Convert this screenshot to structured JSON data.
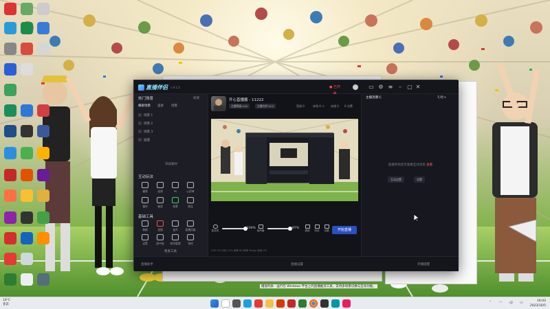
{
  "colors": {
    "accent": "#2a4fbf",
    "live_red": "#ff4d4d",
    "app_bg": "#17181f"
  },
  "app": {
    "title": "直播伴侣",
    "version": "v 9.1.0",
    "titlebar_buttons": [
      "minimize-icon",
      "maximize-icon",
      "close-icon"
    ],
    "left": {
      "section_title": "热门场景",
      "section_action": "新建",
      "tabs": [
        "横屏场景",
        "竖屏",
        "场景"
      ],
      "scenes": [
        "场景 1",
        "场景 2",
        "场景 3",
        "画面"
      ],
      "add_source": "添加素材",
      "interaction_title": "互动玩法",
      "interaction_tools": [
        "福袋",
        "连线",
        "PK",
        "心愿单",
        "福利",
        "抽奖",
        "投票",
        "商品"
      ],
      "basic_title": "基础工具",
      "basic_tools": [
        "美颜",
        "滤镜",
        "变声",
        "直播回放",
        "设置",
        "画中画",
        "房间管理",
        "场控"
      ],
      "more": "更多工具"
    },
    "room": {
      "title": "开心直播酱 - 11222",
      "chips": [
        "主播等级 LV.8",
        "主播守护 LV.3"
      ],
      "stats": [
        "音浪 0",
        "本场 0 人",
        "在线 0",
        "0 点赞"
      ]
    },
    "controls": {
      "mic_label": "麦克风",
      "mic_value": "100%",
      "speaker_label": "扬声器",
      "speaker_value": "97%",
      "mic_level": 1.0,
      "speaker_level": 0.97,
      "icons": [
        "美颜",
        "特效",
        "设置"
      ],
      "start_button": "开始直播"
    },
    "status_line": "CPU 0%  内存 12%  帧率 60  码率 0kbps  丢帧 0%",
    "right": {
      "tab_left": "主播消息",
      "tab_mid": "评论",
      "tab_right": "礼物 ▾",
      "empty_msg": "直播开始后可查看互动消息",
      "empty_link": "查看",
      "btn_a": "互动设置",
      "btn_b": "设置"
    },
    "bottom": [
      "直播助手",
      "直播设置",
      "开播提醒"
    ]
  },
  "taskbar": {
    "weather_temp": "18°C",
    "weather_desc": "多云",
    "time": "16:03",
    "date": "2023/10/5"
  },
  "bg_window": {
    "caption_1": "推荐直播间 开播指南 常见问题说明 使用须知",
    "caption_2": "视频与图片分享中请勿侵犯他人权益，点击下方按钮可查看完整说明",
    "caption_3": "播放列表 · 运行在 Windows 平台上的直播推流工具，支持多场景切换与互动功能。"
  }
}
